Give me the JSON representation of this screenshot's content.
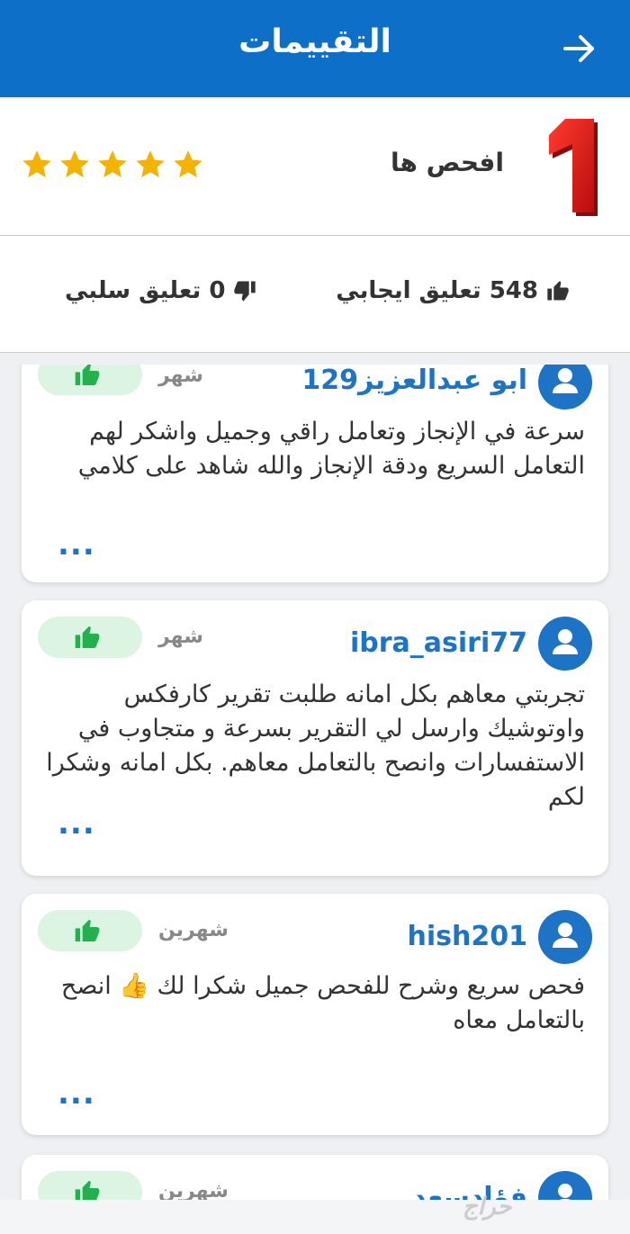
{
  "header": {
    "title": "التقييمات"
  },
  "seller": {
    "name": "افحص ها",
    "logo_text": "1",
    "rating_stars": 5
  },
  "counts": {
    "positive": "548 تعليق ايجابي",
    "negative": "0 تعليق سلبي"
  },
  "reviews": [
    {
      "username": "ابو عبدالعزيز129",
      "time": "شهر",
      "comment": "سرعة في الإنجاز وتعامل راقي وجميل واشكر لهم التعامل السريع ودقة الإنجاز والله شاهد على كلامي",
      "more": "..."
    },
    {
      "username": "ibra_asiri77",
      "time": "شهر",
      "comment": "تجربتي معاهم بكل امانه طلبت تقرير كارفكس واوتوشيك وارسل لي التقرير بسرعة و متجاوب في الاستفسارات وانصح بالتعامل معاهم. بكل امانه وشكرا لكم",
      "more": "..."
    },
    {
      "username": "hish201",
      "time": "شهرين",
      "comment": "فحص سريع وشرح للفحص جميل شكرا لك 👍 انصح بالتعامل معاه",
      "more": "..."
    },
    {
      "username": "فؤادسعد",
      "time": "شهرين",
      "comment": "",
      "more": ""
    }
  ],
  "watermark": "حراج",
  "colors": {
    "header": "#0d6fc7",
    "accent": "#1d73c6",
    "star": "#f5b301",
    "like": "#22b14c",
    "like_bg": "#dcf5e2"
  }
}
